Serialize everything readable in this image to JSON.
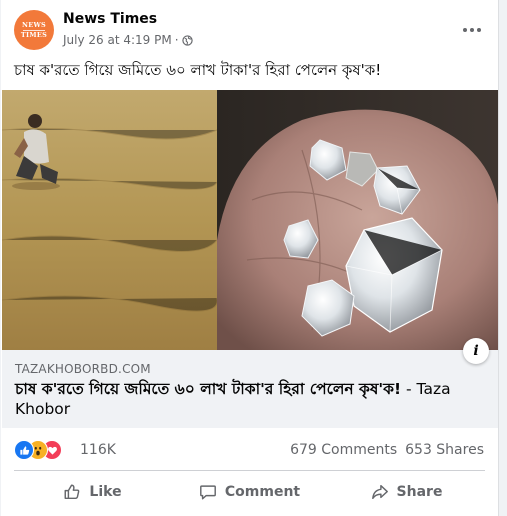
{
  "post": {
    "page_name": "News Times",
    "avatar": {
      "line1": "NEWS",
      "line2": "TIMES"
    },
    "timestamp": "July 26 at 4:19 PM",
    "separator": "·",
    "privacy_icon": "globe-icon",
    "text": "চাষ ক'রতে গিয়ে জমিতে ৬০ লাখ টাকা'র হিরা পেলেন কৃষ'ক!"
  },
  "link": {
    "domain": "TAZAKHOBORBD.COM",
    "title": "চাষ ক'রতে গিয়ে জমিতে ৬০ লাখ টাকা'র হিরা পেলেন কৃষ'ক!",
    "source": " - Taza Khobor",
    "info_label": "i"
  },
  "stats": {
    "reaction_icons": [
      "like-icon",
      "wow-icon",
      "love-icon"
    ],
    "reaction_count": "116K",
    "comments": "679 Comments",
    "shares": "653 Shares"
  },
  "actions": {
    "like": "Like",
    "comment": "Comment",
    "share": "Share"
  },
  "colors": {
    "brand_blue": "#1877f2",
    "love_red": "#f33e58",
    "wow_yellow": "#f7b125",
    "secondary_text": "#65676b",
    "avatar_orange": "#f2793a"
  }
}
